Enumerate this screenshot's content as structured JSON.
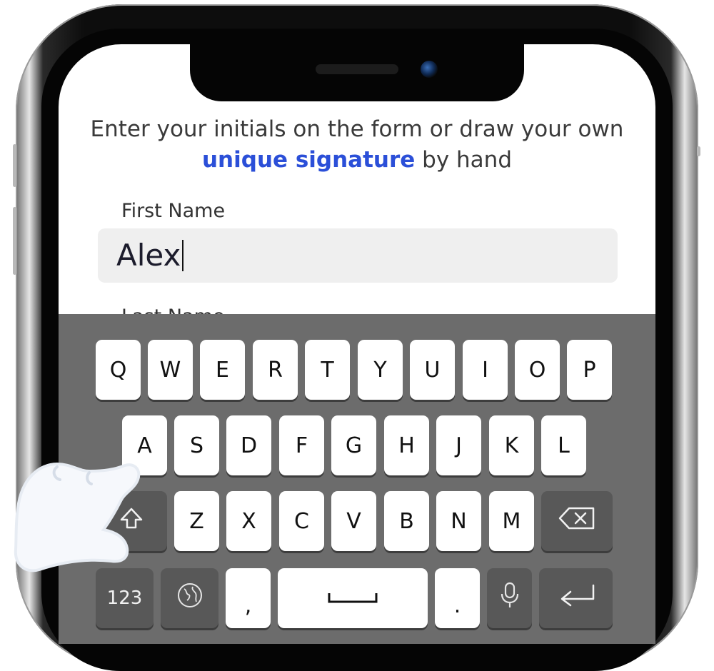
{
  "instruction": {
    "before": "Enter your initials on the form or draw your own ",
    "highlight": "unique signature",
    "after": " by hand"
  },
  "form": {
    "first_name_label": "First Name",
    "first_name_value": "Alex",
    "last_name_label": "Last Name"
  },
  "keyboard": {
    "row1": [
      "Q",
      "W",
      "E",
      "R",
      "T",
      "Y",
      "U",
      "I",
      "O",
      "P"
    ],
    "row2": [
      "A",
      "S",
      "D",
      "F",
      "G",
      "H",
      "J",
      "K",
      "L"
    ],
    "row3": [
      "Z",
      "X",
      "C",
      "V",
      "B",
      "N",
      "M"
    ],
    "numbers_label": "123",
    "comma_label": ",",
    "period_label": ".",
    "icons": {
      "shift": "shift-arrow-icon",
      "backspace": "backspace-icon",
      "globe": "globe-icon",
      "space": "space-bar-icon",
      "mic": "microphone-icon",
      "return": "return-arrow-icon"
    }
  },
  "colors": {
    "highlight": "#2b4fd8",
    "keyboard_bg": "#6c6c6c",
    "key": "#ffffff",
    "key_dark": "#585858"
  }
}
